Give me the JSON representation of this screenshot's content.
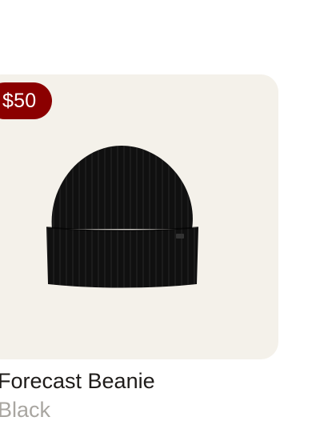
{
  "product": {
    "price": "$50",
    "name": "Forecast Beanie",
    "color": "Black",
    "icon": "beanie-image"
  },
  "colors": {
    "badge": "#8b0000",
    "card_background": "#f4f1ea",
    "beanie": "#111111"
  }
}
